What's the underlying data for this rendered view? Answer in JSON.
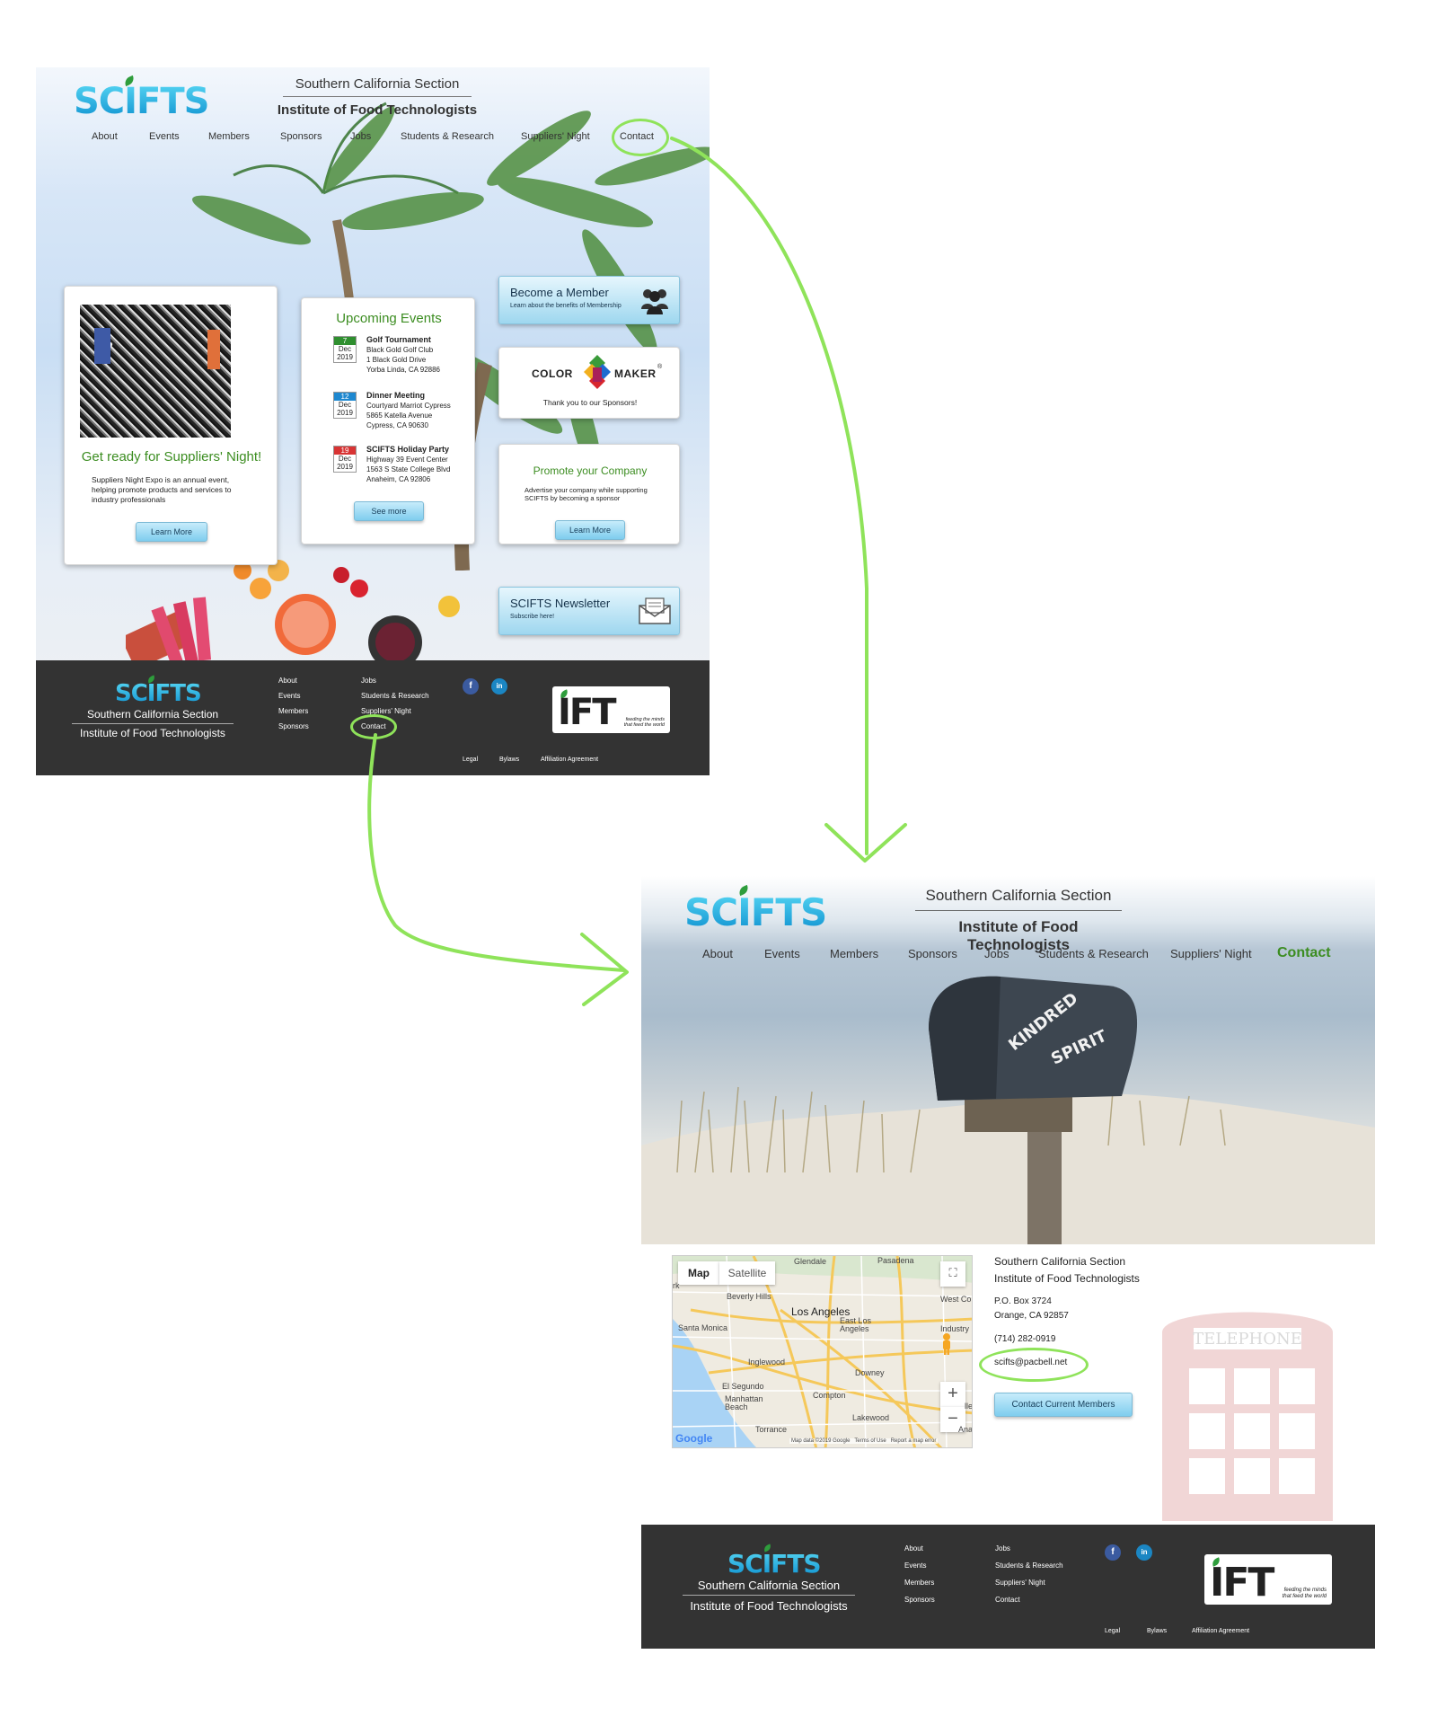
{
  "brand": {
    "logo_text": "SCIFTS",
    "section_line": "Southern California Section",
    "org_line": "Institute of Food Technologists",
    "accent_green": "#3c8d21",
    "accent_blue": "#0d8fcf",
    "annotation_green": "#8fe35a"
  },
  "nav": {
    "about": "About",
    "events": "Events",
    "members": "Members",
    "sponsors": "Sponsors",
    "jobs": "Jobs",
    "students": "Students & Research",
    "suppliers": "Suppliers' Night",
    "contact": "Contact"
  },
  "home": {
    "suppliers_card": {
      "heading": "Get ready for Suppliers' Night!",
      "body": "Suppliers Night Expo is an annual event, helping promote products and services to industry professionals",
      "button": "Learn More"
    },
    "events_card": {
      "heading": "Upcoming Events",
      "button": "See more",
      "events": [
        {
          "day": "7",
          "month": "Dec",
          "year": "2019",
          "title": "Golf Tournament",
          "line1": "Black Gold Golf Club",
          "line2": "1 Black Gold Drive",
          "line3": "Yorba Linda, CA 92886",
          "color": "#2f8f2f"
        },
        {
          "day": "12",
          "month": "Dec",
          "year": "2019",
          "title": "Dinner Meeting",
          "line1": "Courtyard Marriot Cypress",
          "line2": "5865 Katella Avenue",
          "line3": "Cypress, CA 90630",
          "color": "#1e88d0"
        },
        {
          "day": "19",
          "month": "Dec",
          "year": "2019",
          "title": "SCIFTS Holiday Party",
          "line1": "Highway 39 Event Center",
          "line2": "1563 S State College Blvd",
          "line3": "Anaheim, CA 92806",
          "color": "#d83434"
        }
      ]
    },
    "member_button": {
      "title": "Become a Member",
      "subtitle": "Learn about the benefits of Membership",
      "icon": "people-icon"
    },
    "sponsor_card": {
      "logo_left": "COLOR",
      "logo_right": "MAKER",
      "trademark": "®",
      "caption": "Thank you to our Sponsors!"
    },
    "promote_card": {
      "heading": "Promote your Company",
      "body": "Advertise your company while supporting SCIFTS by becoming a sponsor",
      "button": "Learn More"
    },
    "newsletter_button": {
      "title": "SCIFTS Newsletter",
      "subtitle": "Subscribe here!",
      "icon": "envelope-icon"
    }
  },
  "footer": {
    "col1": [
      "About",
      "Events",
      "Members",
      "Sponsors"
    ],
    "col2": [
      "Jobs",
      "Students & Research",
      "Suppliers' Night",
      "Contact"
    ],
    "social": {
      "facebook": "f",
      "linkedin": "in"
    },
    "legal": "Legal",
    "bylaws": "Bylaws",
    "affiliation": "Affiliation Agreement",
    "ift_logo": "IFT",
    "ift_tag1": "feeding the minds",
    "ift_tag2": "that feed the world"
  },
  "contact_page": {
    "hero_sign": "KINDRED SPIRIT",
    "booth_sign": "TELEPHONE",
    "map": {
      "tab_map": "Map",
      "tab_satellite": "Satellite",
      "zoom_in": "+",
      "zoom_out": "−",
      "fullscreen": "⛶",
      "cities": [
        "Glendale",
        "Pasadena",
        "Beverly Hills",
        "Los Angeles",
        "East Los Angeles",
        "West Co",
        "Industry",
        "Santa Monica",
        "Inglewood",
        "Downey",
        "El Segundo",
        "Manhattan Beach",
        "Compton",
        "Lakewood",
        "Torrance",
        "Ana",
        "rk",
        "lle"
      ],
      "google": "Google",
      "attribution": "Map data ©2019 Google   Terms of Use   Report a map error"
    },
    "address": {
      "section": "Southern California Section",
      "org": "Institute of Food Technologists",
      "po": "P.O. Box 3724",
      "city": "Orange, CA 92857",
      "phone": "(714) 282-0919",
      "email": "scifts@pacbell.net"
    },
    "button": "Contact Current Members"
  }
}
